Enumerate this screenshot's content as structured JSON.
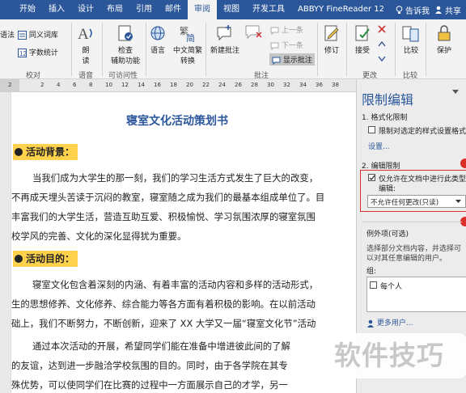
{
  "menubar": {
    "tabs": [
      "开始",
      "插入",
      "设计",
      "布局",
      "引用",
      "邮件",
      "审阅",
      "视图",
      "开发工具",
      "ABBYY FineReader 12"
    ],
    "active_index": 6,
    "tell_me": "告诉我",
    "share": "共享",
    "bg_color": "#2b579a"
  },
  "ribbon": {
    "proofing": {
      "left_partial": "语法",
      "thesaurus": "同义词库",
      "word_count": "字数统计",
      "group": "校对"
    },
    "language_read": {
      "read_l1": "朗",
      "read_l2": "读",
      "group": "语音"
    },
    "accessibility": {
      "l1": "检查",
      "l2": "辅助功能",
      "group": "可访问性"
    },
    "language": {
      "label": "语言"
    },
    "chinese_conv": {
      "l1": "中文简繁",
      "l2": "转换"
    },
    "comments": {
      "new": "新建批注",
      "prev": "上一条",
      "next": "下一条",
      "show": "显示批注",
      "group": "批注"
    },
    "tracking": {
      "label": "修订"
    },
    "changes": {
      "accept": "接受",
      "group": "更改"
    },
    "compare": {
      "label": "比较",
      "group": "比较"
    },
    "protect": {
      "label": "保护"
    }
  },
  "ruler": {
    "ticks": [
      "2",
      "",
      "2",
      "4",
      "6",
      "8",
      "10",
      "12",
      "14",
      "16",
      "18",
      "20",
      "22",
      "24",
      "26",
      "28",
      "30",
      "32",
      "34",
      "36",
      "38"
    ]
  },
  "document": {
    "title": "寝室文化活动策划书",
    "heading1": "活动背景：",
    "para1": [
      "当我们成为大学生的那一刻，我们的学习生活方式发生了巨大的改变，",
      "不再成天埋头苦读于沉闷的教室，寝室随之成为我们的最基本组成单位了。目",
      "丰富我们的大学生活，营造互助互爱、积极愉悦、学习氛围浓厚的寝室氛围",
      "校学风的完善、文化的深化显得犹为重要。"
    ],
    "heading2": "活动目的：",
    "para2": [
      "寝室文化包含着深刻的内涵、有着丰富的活动内容和多样的活动形式，",
      "生的思想修养、文化修养、综合能力等各方面有着积极的影响。在以前活动",
      "础上，我们不断努力，不断创新，迎来了 XX 大学又一届“寝室文化节”活动"
    ],
    "para3": [
      "通过本次活动的开展，希望同学们能在准备中增进彼此间的了解",
      "的友谊，达到进一步融洽学校氛围的目的。同时，由于各学院在其专",
      "殊优势，可以使同学们在比赛的过程中一方面展示自己的才学，另一"
    ]
  },
  "pane": {
    "title": "限制编辑",
    "sec1": "1. 格式化限制",
    "sec1_check": "限制对选定的样式设置格式",
    "sec1_link": "设置...",
    "sec2": "2. 编辑限制",
    "sec2_check_l1": "仅允许在文档中进行此类型",
    "sec2_check_l2": "编辑:",
    "dropdown_value": "不允许任何更改(只读)",
    "exceptions": "例外项(可选)",
    "exc_desc_l1": "选择部分文档内容，并选择可",
    "exc_desc_l2": "以对其任意编辑的用户。",
    "groups_label": "组:",
    "everyone": "每个人",
    "more_users": "更多用户..."
  },
  "watermark": "软件技巧"
}
